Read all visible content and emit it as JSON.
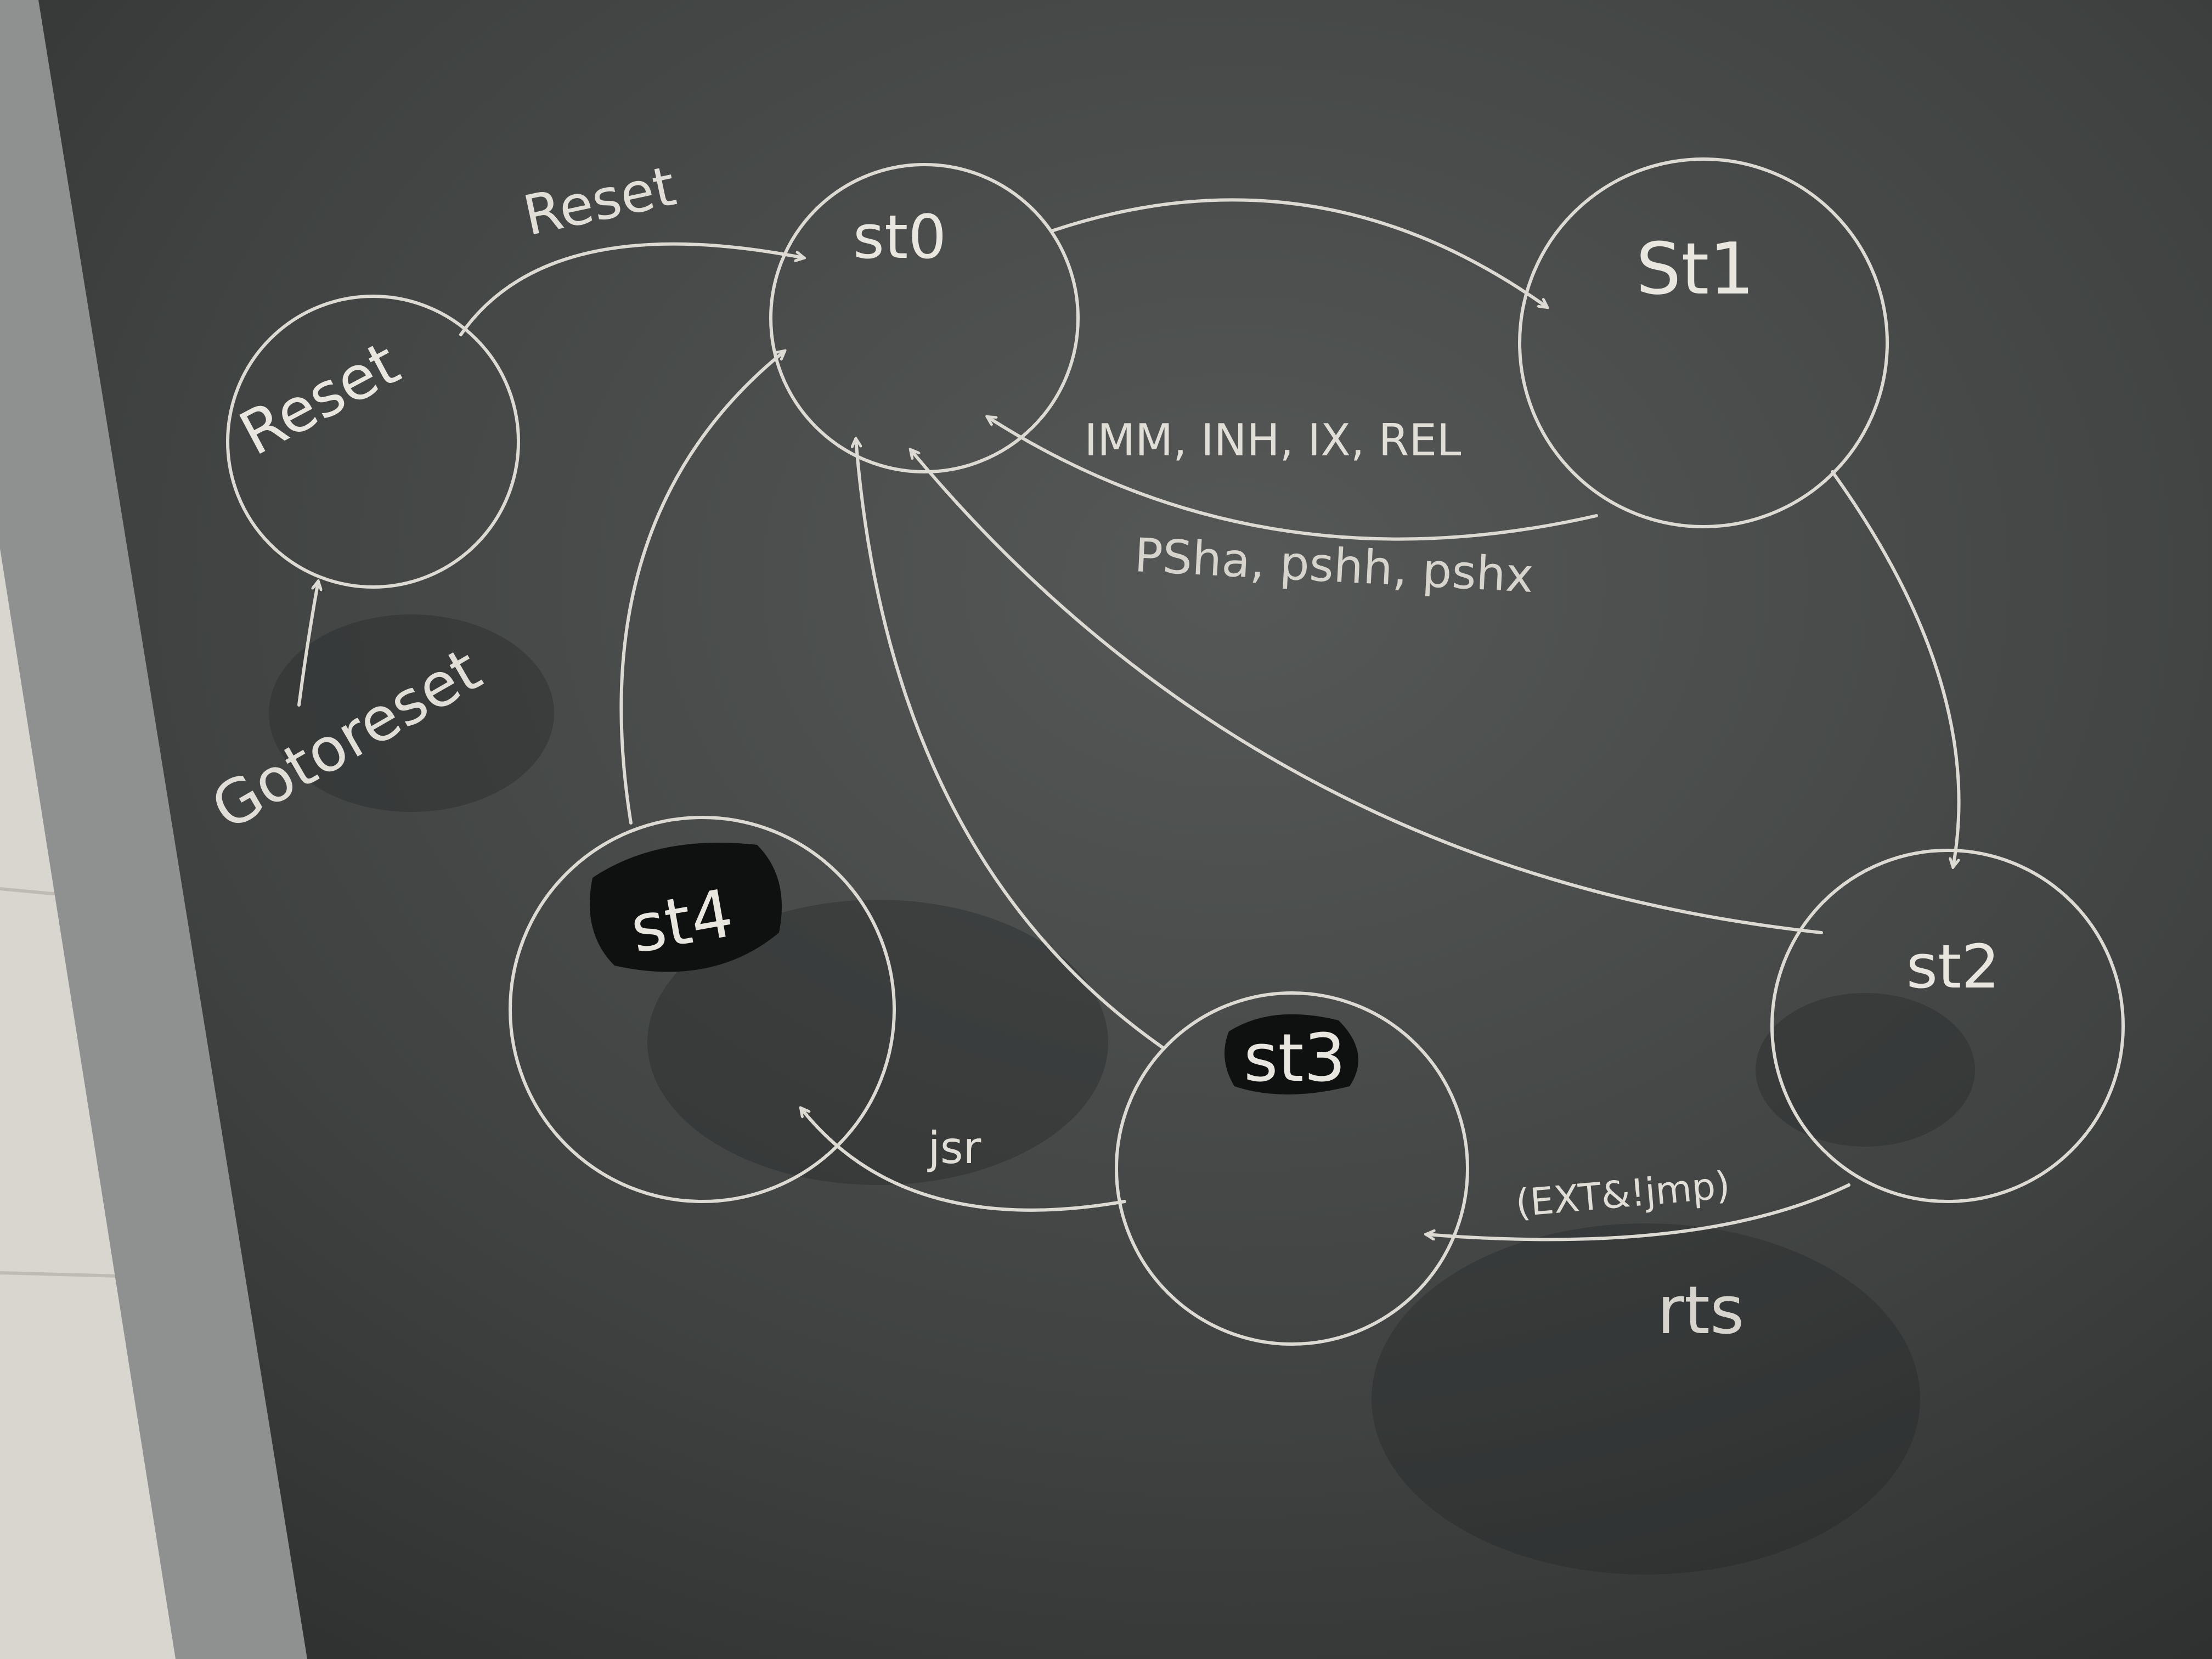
{
  "diagram": {
    "type": "state-machine",
    "states": [
      {
        "id": "reset",
        "label": "Reset"
      },
      {
        "id": "st0",
        "label": "st0"
      },
      {
        "id": "st1",
        "label": "St1"
      },
      {
        "id": "st2",
        "label": "st2"
      },
      {
        "id": "st3",
        "label": "st3"
      },
      {
        "id": "st4",
        "label": "st4"
      }
    ],
    "transitions": [
      {
        "from": "external",
        "to": "reset",
        "label": "Gotoreset"
      },
      {
        "from": "reset",
        "to": "st0",
        "label": "Reset"
      },
      {
        "from": "st0",
        "to": "st1",
        "label": ""
      },
      {
        "from": "st1",
        "to": "st0",
        "label": "IMM, INH, IX, REL"
      },
      {
        "from": "st1",
        "to": "st2",
        "label": ""
      },
      {
        "from": "st2",
        "to": "st0",
        "label": ""
      },
      {
        "from": "st2",
        "to": "st3",
        "label": "(EXT&!jmp)"
      },
      {
        "from": "st3",
        "to": "st0",
        "label": ""
      },
      {
        "from": "st3",
        "to": "st4",
        "label": "jsr"
      },
      {
        "from": "st4",
        "to": "st0",
        "label": ""
      }
    ],
    "notes": [
      {
        "id": "psh",
        "text": "PSha, pshh, pshx"
      },
      {
        "id": "rts",
        "text": "rts"
      }
    ]
  }
}
